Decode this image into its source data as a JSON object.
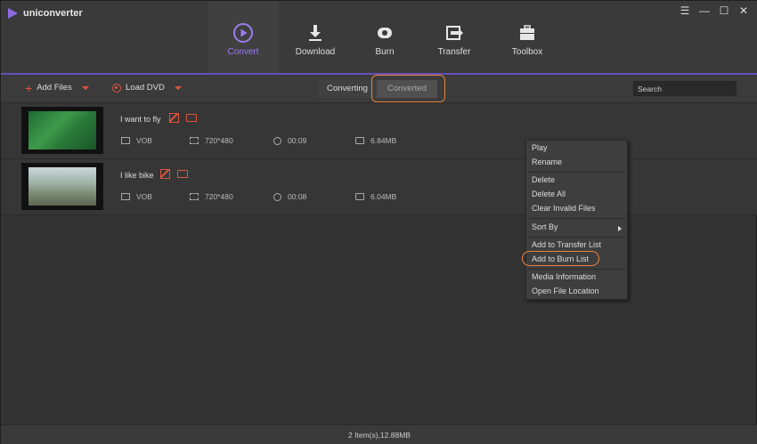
{
  "app": {
    "name": "uniconverter"
  },
  "window_controls": {
    "menu": "☰",
    "minimize": "—",
    "maximize": "☐",
    "close": "✕"
  },
  "nav": [
    {
      "label": "Convert",
      "icon": "convert-icon",
      "active": true
    },
    {
      "label": "Download",
      "icon": "download-icon"
    },
    {
      "label": "Burn",
      "icon": "burn-icon"
    },
    {
      "label": "Transfer",
      "icon": "transfer-icon"
    },
    {
      "label": "Toolbox",
      "icon": "toolbox-icon"
    }
  ],
  "toolbar": {
    "add_files": "Add Files",
    "load_dvd": "Load DVD",
    "tab_converting": "Converting",
    "tab_converted": "Converted",
    "search_placeholder": "Search"
  },
  "files": [
    {
      "name": "I want to fly",
      "format": "VOB",
      "resolution": "720*480",
      "duration": "00:09",
      "size": "6.84MB"
    },
    {
      "name": "I like bike",
      "format": "VOB",
      "resolution": "720*480",
      "duration": "00:08",
      "size": "6.04MB"
    }
  ],
  "context_menu": {
    "items": [
      "Play",
      "Rename",
      "Delete",
      "Delete All",
      "Clear Invalid Files",
      "Sort By",
      "Add to Transfer List",
      "Add to Burn List",
      "Media Information",
      "Open File Location"
    ]
  },
  "status": {
    "summary": "2 Item(s),12.88MB"
  },
  "colors": {
    "accent": "#9d7cf0",
    "orange": "#e0553e",
    "highlight": "#e8823a"
  }
}
